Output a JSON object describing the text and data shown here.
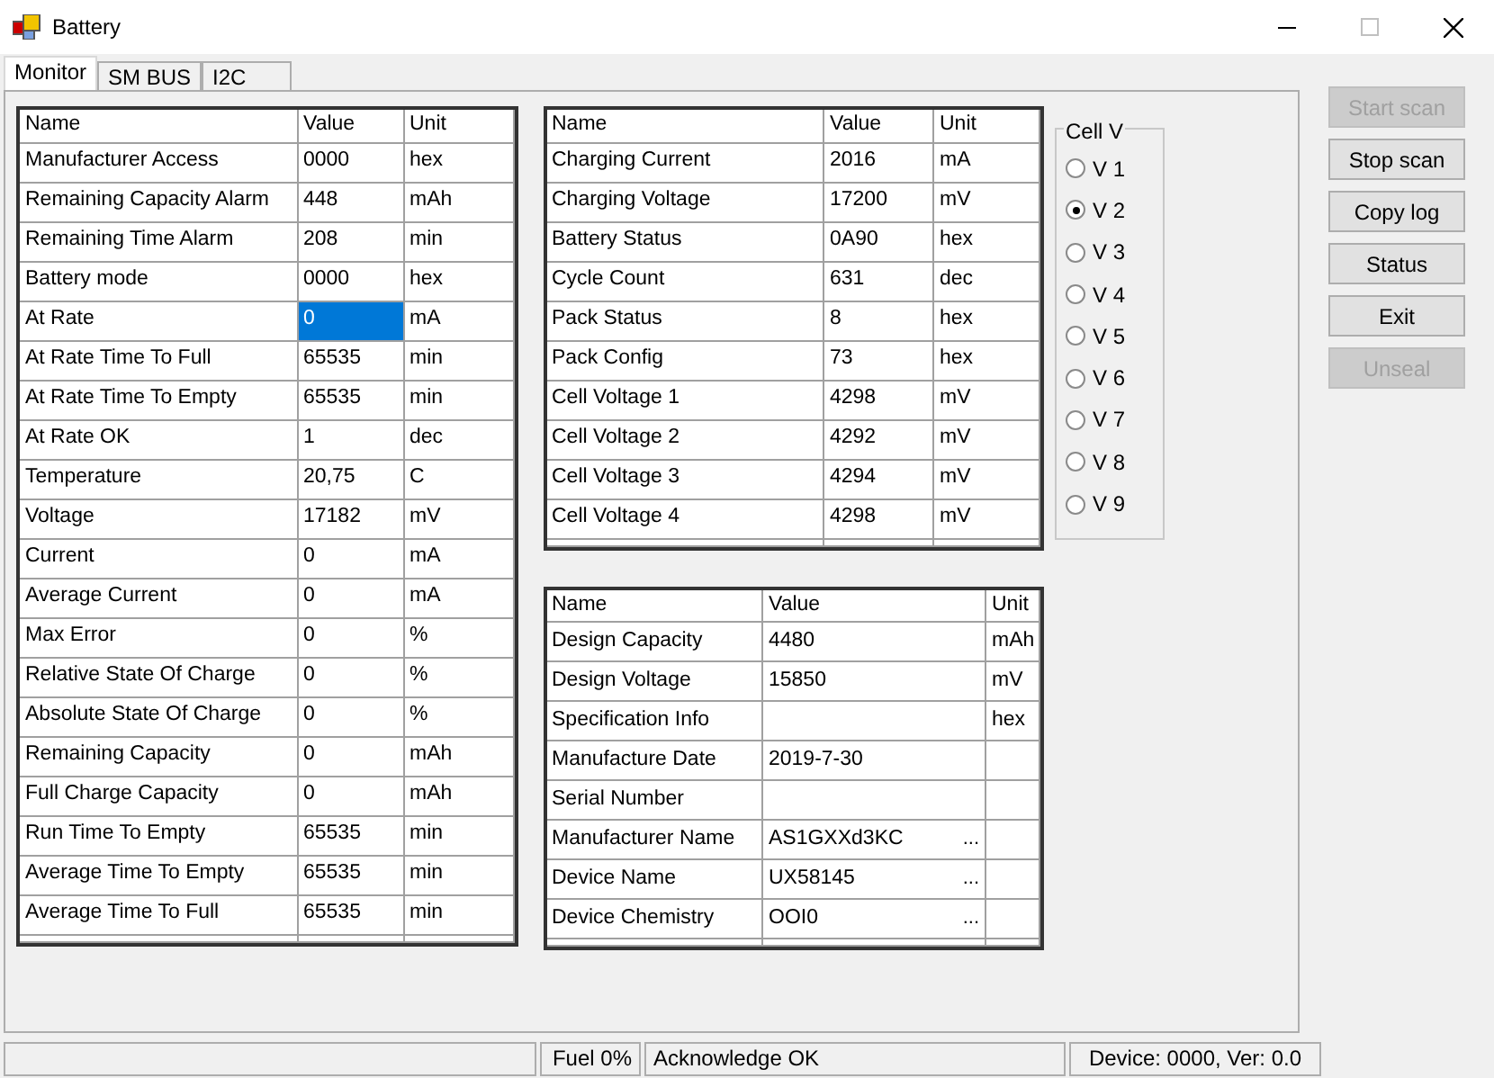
{
  "window": {
    "title": "Battery"
  },
  "tabs": [
    {
      "label": "Monitor",
      "selected": true
    },
    {
      "label": "SM BUS",
      "selected": false
    },
    {
      "label": "I2C",
      "selected": false
    }
  ],
  "grids": [
    {
      "columns": [
        "Name",
        "Value",
        "Unit"
      ],
      "rows": [
        {
          "name": "Manufacturer Access",
          "value": "0000",
          "unit": "hex",
          "selected": false
        },
        {
          "name": "Remaining Capacity Alarm",
          "value": "448",
          "unit": "mAh",
          "selected": false
        },
        {
          "name": "Remaining Time Alarm",
          "value": "208",
          "unit": "min",
          "selected": false
        },
        {
          "name": "Battery mode",
          "value": "0000",
          "unit": "hex",
          "selected": false
        },
        {
          "name": "At Rate",
          "value": "0",
          "unit": "mA",
          "selected": true
        },
        {
          "name": "At Rate Time To Full",
          "value": "65535",
          "unit": "min",
          "selected": false
        },
        {
          "name": "At Rate Time To Empty",
          "value": "65535",
          "unit": "min",
          "selected": false
        },
        {
          "name": "At Rate OK",
          "value": "1",
          "unit": "dec",
          "selected": false
        },
        {
          "name": "Temperature",
          "value": "20,75",
          "unit": "C",
          "selected": false
        },
        {
          "name": "Voltage",
          "value": "17182",
          "unit": "mV",
          "selected": false
        },
        {
          "name": "Current",
          "value": "0",
          "unit": "mA",
          "selected": false
        },
        {
          "name": "Average Current",
          "value": "0",
          "unit": "mA",
          "selected": false
        },
        {
          "name": "Max Error",
          "value": "0",
          "unit": "%",
          "selected": false
        },
        {
          "name": "Relative State Of Charge",
          "value": "0",
          "unit": "%",
          "selected": false
        },
        {
          "name": "Absolute State Of Charge",
          "value": "0",
          "unit": "%",
          "selected": false
        },
        {
          "name": "Remaining Capacity",
          "value": "0",
          "unit": "mAh",
          "selected": false
        },
        {
          "name": "Full Charge Capacity",
          "value": "0",
          "unit": "mAh",
          "selected": false
        },
        {
          "name": "Run Time To Empty",
          "value": "65535",
          "unit": "min",
          "selected": false
        },
        {
          "name": "Average Time To Empty",
          "value": "65535",
          "unit": "min",
          "selected": false
        },
        {
          "name": "Average Time To Full",
          "value": "65535",
          "unit": "min",
          "selected": false
        }
      ]
    },
    {
      "columns": [
        "Name",
        "Value",
        "Unit"
      ],
      "rows": [
        {
          "name": "Charging Current",
          "value": "2016",
          "unit": "mA",
          "selected": false
        },
        {
          "name": "Charging Voltage",
          "value": "17200",
          "unit": "mV",
          "selected": false
        },
        {
          "name": "Battery Status",
          "value": "0A90",
          "unit": "hex",
          "selected": false
        },
        {
          "name": "Cycle Count",
          "value": "631",
          "unit": "dec",
          "selected": false
        },
        {
          "name": "Pack Status",
          "value": "8",
          "unit": "hex",
          "selected": false
        },
        {
          "name": "Pack Config",
          "value": "73",
          "unit": "hex",
          "selected": false
        },
        {
          "name": "Cell Voltage 1",
          "value": "4298",
          "unit": "mV",
          "selected": false
        },
        {
          "name": "Cell Voltage 2",
          "value": "4292",
          "unit": "mV",
          "selected": false
        },
        {
          "name": "Cell Voltage 3",
          "value": "4294",
          "unit": "mV",
          "selected": false
        },
        {
          "name": "Cell Voltage 4",
          "value": "4298",
          "unit": "mV",
          "selected": false
        }
      ]
    },
    {
      "columns": [
        "Name",
        "Value",
        "Unit"
      ],
      "rows": [
        {
          "name": "Design Capacity",
          "value": "4480",
          "unit": "mAh",
          "selected": false
        },
        {
          "name": "Design Voltage",
          "value": "15850",
          "unit": "mV",
          "selected": false
        },
        {
          "name": "Specification Info",
          "unit": "hex",
          "selected": false
        },
        {
          "name": "Manufacture Date",
          "value": "2019-7-30",
          "selected": false
        },
        {
          "name": "Serial Number",
          "selected": false
        },
        {
          "name": "Manufacturer Name",
          "value": "AS1GXXd3KC",
          "button": "...",
          "selected": false
        },
        {
          "name": "Device Name",
          "value": "UX58145",
          "button": "...",
          "selected": false
        },
        {
          "name": "Device Chemistry",
          "value": "OOI0",
          "button": "...",
          "selected": false
        }
      ]
    }
  ],
  "cell_v": {
    "title": "Cell V",
    "options": [
      {
        "label": "V 1",
        "selected": false
      },
      {
        "label": "V 2",
        "selected": true
      },
      {
        "label": "V 3",
        "selected": false
      },
      {
        "label": "V 4",
        "selected": false
      },
      {
        "label": "V 5",
        "selected": false
      },
      {
        "label": "V 6",
        "selected": false
      },
      {
        "label": "V 7",
        "selected": false
      },
      {
        "label": "V 8",
        "selected": false
      },
      {
        "label": "V 9",
        "selected": false
      }
    ]
  },
  "buttons": [
    {
      "label": "Start scan",
      "disabled": true
    },
    {
      "label": "Stop scan",
      "disabled": false
    },
    {
      "label": "Copy log",
      "disabled": false
    },
    {
      "label": "Status",
      "disabled": false
    },
    {
      "label": "Exit",
      "disabled": false
    },
    {
      "label": "Unseal",
      "disabled": true
    }
  ],
  "status_bar": [
    "Fuel 0%",
    "Acknowledge OK",
    "Device: 0000, Ver: 0.0"
  ]
}
